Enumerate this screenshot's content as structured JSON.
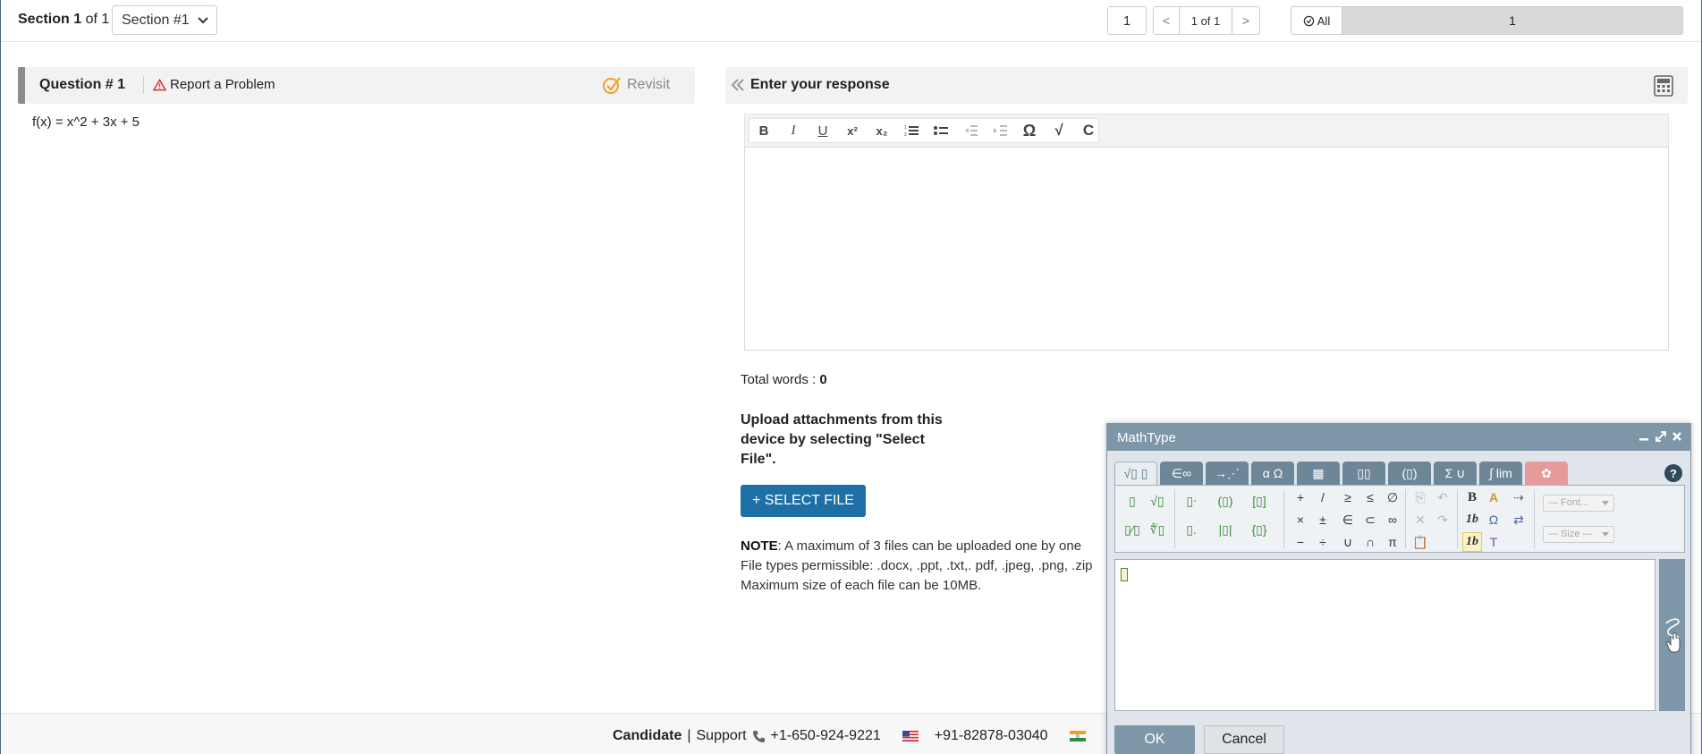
{
  "topbar": {
    "section_word": "Section",
    "section_num": "1",
    "section_of": "of 1",
    "section_select_value": "Section #1",
    "page_current": "1",
    "page_prev": "<",
    "page_of": "1 of 1",
    "page_next": ">",
    "all_label": "All",
    "all_bar_value": "1"
  },
  "question": {
    "title": "Question # 1",
    "report_label": "Report a Problem",
    "revisit_label": "Revisit",
    "text": "f(x) = x^2 + 3x + 5"
  },
  "response": {
    "title": "Enter your response",
    "words_label": "Total words :",
    "words_count": "0",
    "upload_text": "Upload attachments from this device by selecting \"Select File\".",
    "select_file_label": "+ SELECT FILE",
    "note_label": "NOTE",
    "note_line1": ":  A maximum of 3 files can be uploaded one by one",
    "note_line2": "File types permissible: .docx, .ppt, .txt,. pdf, .jpeg, .png, .zip",
    "note_line3": "Maximum size of each file can be 10MB."
  },
  "toolbar": {
    "buttons": [
      "B",
      "I",
      "U",
      "x²",
      "x₂",
      "ordered-list",
      "bullet-list",
      "indent-decrease",
      "indent-increase",
      "Ω",
      "√",
      "C"
    ]
  },
  "footer": {
    "candidate": "Candidate",
    "separator": "|",
    "support": "Support",
    "phone_us": "+1-650-924-9221",
    "phone_in": "+91-82878-03040"
  },
  "mathtype": {
    "title": "MathType",
    "tabs": [
      "√▯ ▯",
      "∈∞",
      "→⋰",
      "α Ω",
      "▦",
      "▯▯",
      "(▯)",
      "Σ ∪",
      "∫ lim",
      "✿"
    ],
    "help": "?",
    "font_placeholder": "— Font... ",
    "size_placeholder": "— Size —",
    "ok_label": "OK",
    "cancel_label": "Cancel"
  },
  "colors": {
    "select_file_bg": "#1d6fa5",
    "mathtype_title_bg": "#7e97a8",
    "warning_red": "#d9342b",
    "revisit_orange": "#f0a030"
  }
}
